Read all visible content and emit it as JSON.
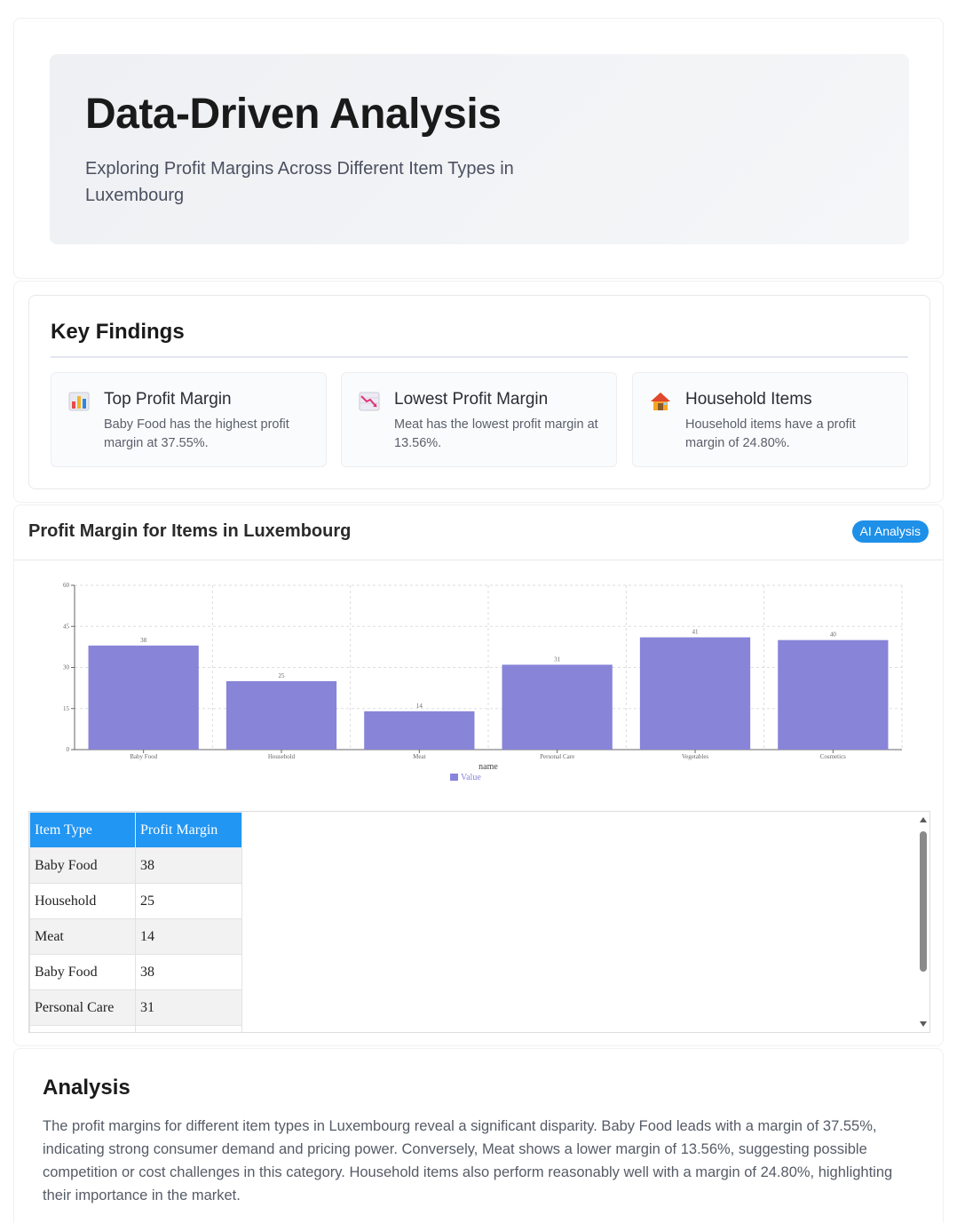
{
  "hero": {
    "title": "Data-Driven Analysis",
    "subtitle": "Exploring Profit Margins Across Different Item Types in Luxembourg"
  },
  "findings": {
    "title": "Key Findings",
    "items": [
      {
        "icon": "bar-chart-icon",
        "title": "Top Profit Margin",
        "text": "Baby Food has the highest profit margin at 37.55%."
      },
      {
        "icon": "chart-decreasing-icon",
        "title": "Lowest Profit Margin",
        "text": "Meat has the lowest profit margin at 13.56%."
      },
      {
        "icon": "house-icon",
        "title": "Household Items",
        "text": "Household items have a profit margin of 24.80%."
      }
    ]
  },
  "chart_section": {
    "title": "Profit Margin for Items in Luxembourg",
    "badge": "AI Analysis"
  },
  "chart_data": {
    "type": "bar",
    "categories": [
      "Baby Food",
      "Household",
      "Meat",
      "Personal Care",
      "Vegetables",
      "Cosmetics"
    ],
    "series": [
      {
        "name": "Value",
        "values": [
          38,
          25,
          14,
          31,
          41,
          40
        ]
      }
    ],
    "xlabel": "name",
    "ylabel": "",
    "ylim": [
      0,
      60
    ],
    "yticks": [
      0,
      15,
      30,
      45,
      60
    ],
    "grid": true,
    "legend": "bottom-center",
    "bar_color": "#8884d8"
  },
  "table": {
    "headers": [
      "Item Type",
      "Profit Margin"
    ],
    "rows": [
      [
        "Baby Food",
        "38"
      ],
      [
        "Household",
        "25"
      ],
      [
        "Meat",
        "14"
      ],
      [
        "Baby Food",
        "38"
      ],
      [
        "Personal Care",
        "31"
      ],
      [
        "",
        ""
      ]
    ],
    "header_color": "#2196f3"
  },
  "analysis": {
    "title": "Analysis",
    "text": "The profit margins for different item types in Luxembourg reveal a significant disparity. Baby Food leads with a margin of 37.55%, indicating strong consumer demand and pricing power. Conversely, Meat shows a lower margin of 13.56%, suggesting possible competition or cost challenges in this category. Household items also perform reasonably well with a margin of 24.80%, highlighting their importance in the market."
  }
}
